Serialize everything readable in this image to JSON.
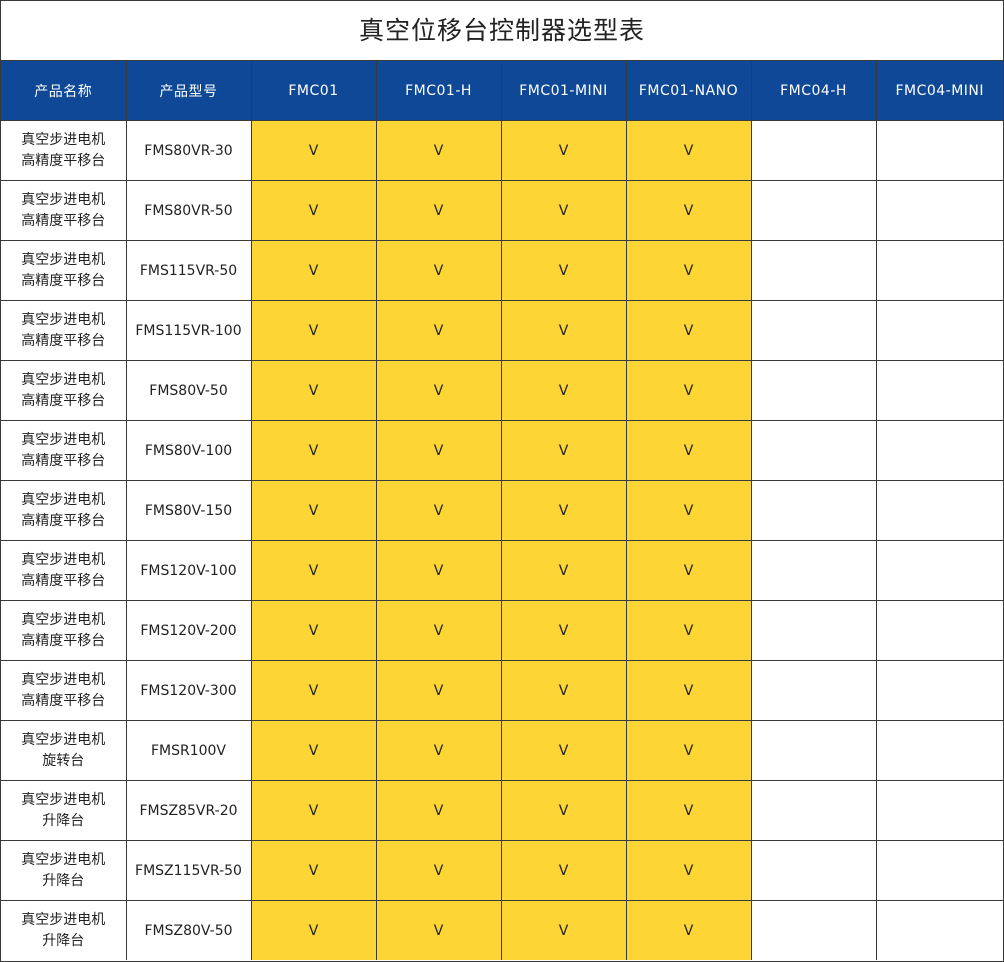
{
  "title": "真空位移台控制器选型表",
  "colors": {
    "header_bg": "#0f4897",
    "header_text": "#ffffff",
    "mark_bg": "#fdd535",
    "border": "#3a3a3a"
  },
  "headers": [
    "产品名称",
    "产品型号",
    "FMC01",
    "FMC01-H",
    "FMC01-MINI",
    "FMC01-NANO",
    "FMC04-H",
    "FMC04-MINI"
  ],
  "rows": [
    {
      "name1": "真空步进电机",
      "name2": "高精度平移台",
      "model": "FMS80VR-30",
      "marks": [
        "V",
        "V",
        "V",
        "V",
        "",
        ""
      ]
    },
    {
      "name1": "真空步进电机",
      "name2": "高精度平移台",
      "model": "FMS80VR-50",
      "marks": [
        "V",
        "V",
        "V",
        "V",
        "",
        ""
      ]
    },
    {
      "name1": "真空步进电机",
      "name2": "高精度平移台",
      "model": "FMS115VR-50",
      "marks": [
        "V",
        "V",
        "V",
        "V",
        "",
        ""
      ]
    },
    {
      "name1": "真空步进电机",
      "name2": "高精度平移台",
      "model": "FMS115VR-100",
      "marks": [
        "V",
        "V",
        "V",
        "V",
        "",
        ""
      ]
    },
    {
      "name1": "真空步进电机",
      "name2": "高精度平移台",
      "model": "FMS80V-50",
      "marks": [
        "V",
        "V",
        "V",
        "V",
        "",
        ""
      ]
    },
    {
      "name1": "真空步进电机",
      "name2": "高精度平移台",
      "model": "FMS80V-100",
      "marks": [
        "V",
        "V",
        "V",
        "V",
        "",
        ""
      ]
    },
    {
      "name1": "真空步进电机",
      "name2": "高精度平移台",
      "model": "FMS80V-150",
      "marks": [
        "V",
        "V",
        "V",
        "V",
        "",
        ""
      ]
    },
    {
      "name1": "真空步进电机",
      "name2": "高精度平移台",
      "model": "FMS120V-100",
      "marks": [
        "V",
        "V",
        "V",
        "V",
        "",
        ""
      ]
    },
    {
      "name1": "真空步进电机",
      "name2": "高精度平移台",
      "model": "FMS120V-200",
      "marks": [
        "V",
        "V",
        "V",
        "V",
        "",
        ""
      ]
    },
    {
      "name1": "真空步进电机",
      "name2": "高精度平移台",
      "model": "FMS120V-300",
      "marks": [
        "V",
        "V",
        "V",
        "V",
        "",
        ""
      ]
    },
    {
      "name1": "真空步进电机",
      "name2": "旋转台",
      "model": "FMSR100V",
      "marks": [
        "V",
        "V",
        "V",
        "V",
        "",
        ""
      ]
    },
    {
      "name1": "真空步进电机",
      "name2": "升降台",
      "model": "FMSZ85VR-20",
      "marks": [
        "V",
        "V",
        "V",
        "V",
        "",
        ""
      ]
    },
    {
      "name1": "真空步进电机",
      "name2": "升降台",
      "model": "FMSZ115VR-50",
      "marks": [
        "V",
        "V",
        "V",
        "V",
        "",
        ""
      ]
    },
    {
      "name1": "真空步进电机",
      "name2": "升降台",
      "model": "FMSZ80V-50",
      "marks": [
        "V",
        "V",
        "V",
        "V",
        "",
        ""
      ]
    }
  ]
}
